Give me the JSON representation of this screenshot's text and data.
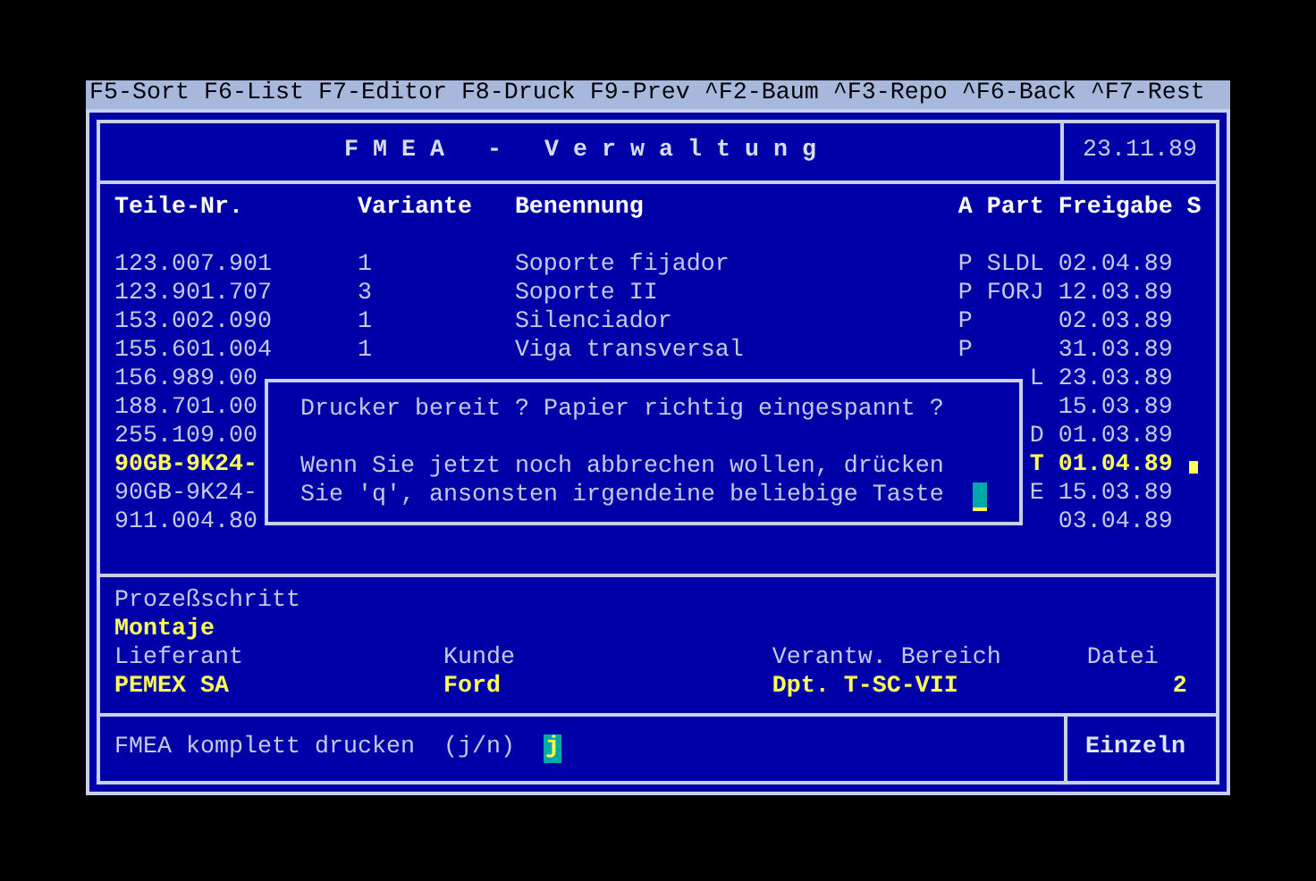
{
  "menu": [
    "F5-Sort",
    "F6-List",
    "F7-Editor",
    "F8-Druck",
    "F9-Prev",
    "^F2-Baum",
    "^F3-Repo",
    "^F6-Back",
    "^F7-Rest"
  ],
  "header": {
    "title": "F M E A   -   V e r w a l t u n g",
    "date": "23.11.89"
  },
  "table": {
    "columns": [
      "Teile-Nr.",
      "Variante",
      "Benennung",
      "A",
      "Part",
      "Freigabe",
      "S"
    ],
    "rows": [
      {
        "teile_nr": "123.007.901",
        "variante": "1",
        "benennung": "Soporte fijador",
        "a": "P",
        "part": "SLDL",
        "freigabe": "02.04.89",
        "selected": false
      },
      {
        "teile_nr": "123.901.707",
        "variante": "3",
        "benennung": "Soporte II",
        "a": "P",
        "part": "FORJ",
        "freigabe": "12.03.89",
        "selected": false
      },
      {
        "teile_nr": "153.002.090",
        "variante": "1",
        "benennung": "Silenciador",
        "a": "P",
        "freigabe": "02.03.89",
        "selected": false
      },
      {
        "teile_nr": "155.601.004",
        "variante": "1",
        "benennung": "Viga transversal",
        "a": "P",
        "freigabe": "31.03.89",
        "selected": false
      },
      {
        "teile_nr": "156.989.00",
        "part": "L",
        "freigabe": "23.03.89",
        "selected": false
      },
      {
        "teile_nr": "188.701.00",
        "freigabe": "15.03.89",
        "selected": false
      },
      {
        "teile_nr": "255.109.00",
        "part": "D",
        "freigabe": "01.03.89",
        "selected": false
      },
      {
        "teile_nr": "90GB-9K24-",
        "part": "T",
        "freigabe": "01.04.89",
        "selected": true
      },
      {
        "teile_nr": "90GB-9K24-",
        "part": "E",
        "freigabe": "15.03.89",
        "selected": false
      },
      {
        "teile_nr": "911.004.80",
        "freigabe": "03.04.89",
        "selected": false
      }
    ]
  },
  "dialog": {
    "lines": [
      "Drucker bereit ? Papier richtig eingespannt ?",
      "Wenn Sie jetzt noch abbrechen wollen, drücken",
      "Sie 'q', ansonsten irgendeine beliebige Taste"
    ]
  },
  "details": {
    "process_label": "Prozeßschritt",
    "process_value": "Montaje",
    "fields": [
      {
        "label": "Lieferant",
        "value": "PEMEX SA"
      },
      {
        "label": "Kunde",
        "value": "Ford"
      },
      {
        "label": "Verantw. Bereich",
        "value": "Dpt. T-SC-VII"
      },
      {
        "label": "Datei",
        "value": "2"
      }
    ]
  },
  "prompt": {
    "label": "FMEA komplett drucken",
    "hint": "(j/n)",
    "value": "j"
  },
  "mode": "Einzeln"
}
